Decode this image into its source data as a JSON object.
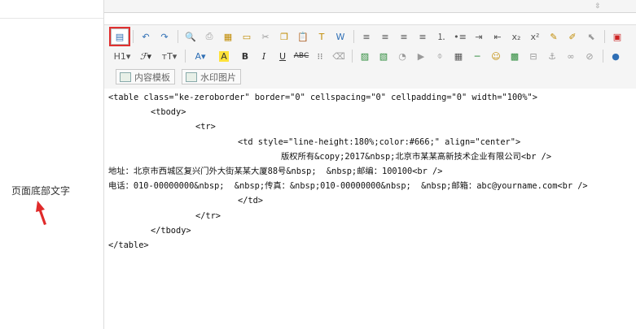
{
  "field": {
    "label": "页面底部文字"
  },
  "toolbar": {
    "row1": [
      {
        "name": "source-code-icon",
        "glyph": "▤",
        "cls": "blue",
        "type": "source"
      },
      {
        "sep": true
      },
      {
        "name": "undo-icon",
        "glyph": "↶",
        "cls": "blue"
      },
      {
        "name": "redo-icon",
        "glyph": "↷",
        "cls": "blue"
      },
      {
        "sep": true
      },
      {
        "name": "preview-icon",
        "glyph": "🔍",
        "cls": "gray"
      },
      {
        "name": "print-icon",
        "glyph": "⎙",
        "cls": "gray"
      },
      {
        "name": "template-icon",
        "glyph": "▦",
        "cls": "gold"
      },
      {
        "name": "code-icon",
        "glyph": "▭",
        "cls": "gold"
      },
      {
        "name": "cut-icon",
        "glyph": "✂",
        "cls": "gray"
      },
      {
        "name": "copy-icon",
        "glyph": "❐",
        "cls": "gold"
      },
      {
        "name": "paste-icon",
        "glyph": "📋",
        "cls": "gold"
      },
      {
        "name": "paste-plain-icon",
        "glyph": "T",
        "cls": "gold"
      },
      {
        "name": "paste-word-icon",
        "glyph": "W",
        "cls": "blue"
      },
      {
        "sep": true
      },
      {
        "name": "align-left-icon",
        "glyph": "≡",
        "cls": ""
      },
      {
        "name": "align-center-icon",
        "glyph": "≡",
        "cls": ""
      },
      {
        "name": "align-right-icon",
        "glyph": "≡",
        "cls": ""
      },
      {
        "name": "align-justify-icon",
        "glyph": "≡",
        "cls": ""
      },
      {
        "name": "ordered-list-icon",
        "glyph": "⒈",
        "cls": ""
      },
      {
        "name": "unordered-list-icon",
        "glyph": "•≡",
        "cls": ""
      },
      {
        "name": "indent-icon",
        "glyph": "⇥",
        "cls": ""
      },
      {
        "name": "outdent-icon",
        "glyph": "⇤",
        "cls": ""
      },
      {
        "name": "subscript-icon",
        "glyph": "x₂",
        "cls": ""
      },
      {
        "name": "superscript-icon",
        "glyph": "x²",
        "cls": ""
      },
      {
        "name": "clear-format-icon",
        "glyph": "✎",
        "cls": "gold"
      },
      {
        "name": "quick-format-icon",
        "glyph": "✐",
        "cls": "gold"
      },
      {
        "name": "select-all-icon",
        "glyph": "⬉",
        "cls": "gray"
      },
      {
        "sep": true
      },
      {
        "name": "fullscreen-icon",
        "glyph": "▣",
        "cls": "red"
      }
    ],
    "row2": [
      {
        "name": "heading-icon",
        "glyph": "H1▾",
        "cls": "",
        "wide": true
      },
      {
        "name": "font-family-icon",
        "glyph": "ℱ▾",
        "cls": "i",
        "wide": true
      },
      {
        "name": "font-size-icon",
        "glyph": "ᴛT▾",
        "cls": "",
        "wide": true
      },
      {
        "sep": true
      },
      {
        "name": "font-color-icon",
        "glyph": "A▾",
        "cls": "blue",
        "wide": true
      },
      {
        "name": "highlight-color-icon",
        "glyph": "A",
        "cls": "",
        "hl": true,
        "wide": true
      },
      {
        "name": "bold-icon",
        "glyph": "B",
        "cls": "b"
      },
      {
        "name": "italic-icon",
        "glyph": "I",
        "cls": "i"
      },
      {
        "name": "underline-icon",
        "glyph": "U",
        "cls": "u"
      },
      {
        "name": "strikethrough-icon",
        "glyph": "ABC",
        "cls": "s"
      },
      {
        "name": "line-height-icon",
        "glyph": "⁝⁝",
        "cls": ""
      },
      {
        "name": "remove-format-icon",
        "glyph": "⌫",
        "cls": "gray"
      },
      {
        "sep": true
      },
      {
        "name": "image-icon",
        "glyph": "▨",
        "cls": "green"
      },
      {
        "name": "multi-image-icon",
        "glyph": "▧",
        "cls": "green"
      },
      {
        "name": "flash-icon",
        "glyph": "◔",
        "cls": "gray"
      },
      {
        "name": "media-icon",
        "glyph": "▶",
        "cls": "gray"
      },
      {
        "name": "attachment-icon",
        "glyph": "⌽",
        "cls": "gray"
      },
      {
        "name": "table-icon",
        "glyph": "▦",
        "cls": ""
      },
      {
        "name": "horizontal-rule-icon",
        "glyph": "─",
        "cls": "green"
      },
      {
        "name": "emoticon-icon",
        "glyph": "☺",
        "cls": "gold"
      },
      {
        "name": "baidu-map-icon",
        "glyph": "▩",
        "cls": "green"
      },
      {
        "name": "page-break-icon",
        "glyph": "⊟",
        "cls": "gray"
      },
      {
        "name": "anchor-icon",
        "glyph": "⚓",
        "cls": "gray"
      },
      {
        "name": "link-icon",
        "glyph": "∞",
        "cls": "gray"
      },
      {
        "name": "unlink-icon",
        "glyph": "⊘",
        "cls": "gray"
      },
      {
        "sep": true
      },
      {
        "name": "about-icon",
        "glyph": "●",
        "cls": "blue"
      }
    ]
  },
  "template_buttons": [
    {
      "name": "content-template-button",
      "label": "内容模板"
    },
    {
      "name": "watermark-image-button",
      "label": "水印图片"
    }
  ],
  "code_lines": [
    {
      "indent": 0,
      "text": "<table class=\"ke-zeroborder\" border=\"0\" cellspacing=\"0\" cellpadding=\"0\" width=\"100%\">"
    },
    {
      "indent": 1,
      "text": "<tbody>"
    },
    {
      "indent": 2,
      "text": "<tr>"
    },
    {
      "indent": 3,
      "text": "<td style=\"line-height:180%;color:#666;\" align=\"center\">"
    },
    {
      "indent": 4,
      "text": "版权所有&copy;2017&nbsp;北京市某某高新技术企业有限公司<br />"
    },
    {
      "indent": 0,
      "text": "地址：北京市西城区复兴门外大街某某大厦88号&nbsp;  &nbsp;邮编：100100<br />"
    },
    {
      "indent": 0,
      "text": "电话：010-00000000&nbsp;  &nbsp;传真：&nbsp;010-00000000&nbsp;  &nbsp;邮箱：abc@yourname.com<br />"
    },
    {
      "indent": 3,
      "text": "</td>"
    },
    {
      "indent": 2,
      "text": "</tr>"
    },
    {
      "indent": 1,
      "text": "</tbody>"
    },
    {
      "indent": 0,
      "text": "</table>"
    }
  ],
  "colors": {
    "highlight": "#e03030",
    "toolbar_bg": "#f5f5f5"
  }
}
